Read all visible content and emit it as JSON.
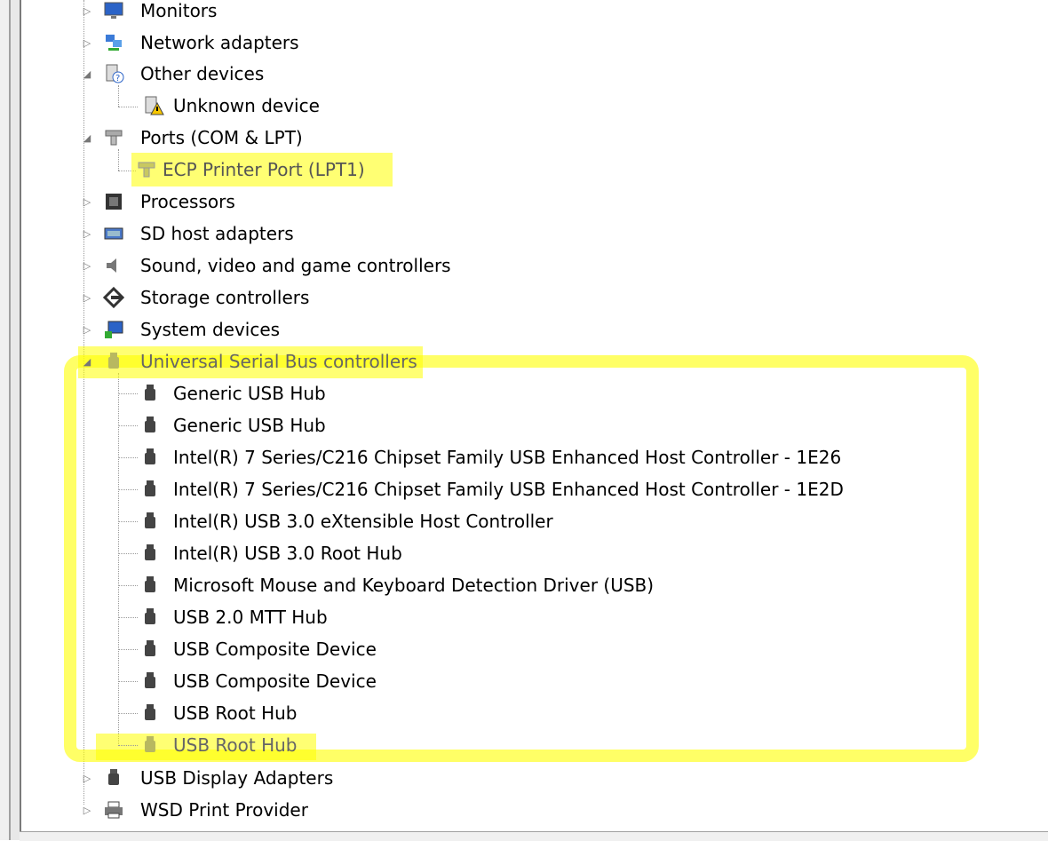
{
  "tree": {
    "top": [
      {
        "id": "monitors",
        "label": "Monitors",
        "icon": "monitor-icon",
        "state": "collapsed"
      },
      {
        "id": "network",
        "label": "Network adapters",
        "icon": "network-adapter-icon",
        "state": "collapsed"
      },
      {
        "id": "other",
        "label": "Other devices",
        "icon": "unknown-device-icon",
        "state": "expanded"
      },
      {
        "id": "unknown",
        "label": "Unknown device",
        "icon": "warning-device-icon",
        "state": "child"
      },
      {
        "id": "ports",
        "label": "Ports (COM & LPT)",
        "icon": "port-icon",
        "state": "expanded"
      },
      {
        "id": "ecp",
        "label": "ECP Printer Port (LPT1)",
        "icon": "port-icon",
        "state": "child"
      },
      {
        "id": "processors",
        "label": "Processors",
        "icon": "processor-icon",
        "state": "collapsed"
      },
      {
        "id": "sdhost",
        "label": "SD host adapters",
        "icon": "sd-adapter-icon",
        "state": "collapsed"
      },
      {
        "id": "sound",
        "label": "Sound, video and game controllers",
        "icon": "speaker-icon",
        "state": "collapsed"
      },
      {
        "id": "storage",
        "label": "Storage controllers",
        "icon": "storage-icon",
        "state": "collapsed"
      },
      {
        "id": "system",
        "label": "System devices",
        "icon": "system-device-icon",
        "state": "collapsed"
      },
      {
        "id": "usb",
        "label": "Universal Serial Bus controllers",
        "icon": "usb-plug-icon",
        "state": "expanded"
      }
    ],
    "usb_children": [
      "Generic USB Hub",
      "Generic USB Hub",
      "Intel(R) 7 Series/C216 Chipset Family USB Enhanced Host Controller - 1E26",
      "Intel(R) 7 Series/C216 Chipset Family USB Enhanced Host Controller - 1E2D",
      "Intel(R) USB 3.0 eXtensible Host Controller",
      "Intel(R) USB 3.0 Root Hub",
      "Microsoft Mouse and Keyboard Detection Driver (USB)",
      "USB 2.0 MTT Hub",
      "USB Composite Device",
      "USB Composite Device",
      "USB Root Hub",
      "USB Root Hub"
    ],
    "bottom": [
      {
        "id": "usbdisplay",
        "label": "USB Display Adapters",
        "icon": "usb-plug-icon",
        "state": "collapsed"
      },
      {
        "id": "wsd",
        "label": "WSD Print Provider",
        "icon": "printer-icon",
        "state": "collapsed"
      }
    ]
  },
  "highlight_color": "#ffff00"
}
